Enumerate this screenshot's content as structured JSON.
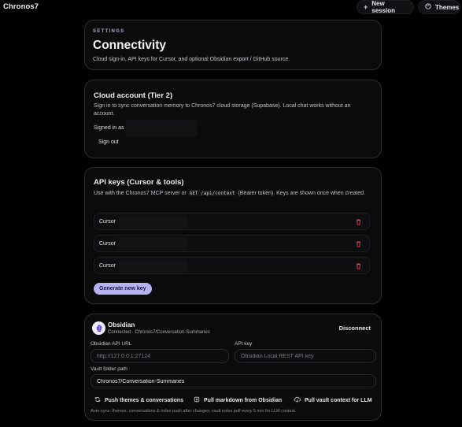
{
  "app": {
    "brand": "Chronos7"
  },
  "topbar": {
    "new_session": {
      "label": "New session",
      "icon": "plus-icon"
    },
    "themes": {
      "label": "Themes",
      "icon": "palette-icon"
    }
  },
  "settings": {
    "eyebrow": "SETTINGS",
    "title": "Connectivity",
    "subtitle": "Cloud sign-in, API keys for Cursor, and optional Obsidian export / GitHub source."
  },
  "cloud": {
    "title": "Cloud account (Tier 2)",
    "desc": "Sign in to sync conversation memory to Chronos7 cloud storage (Supabase). Local chat works without an account.",
    "signed_in_label": "Signed in as",
    "sign_out": "Sign out"
  },
  "api_keys": {
    "title": "API keys (Cursor & tools)",
    "desc_pre": "Use with the Chronos7 MCP server or ",
    "desc_code": "GET /api/context",
    "desc_post": " (Bearer token). Keys are shown once when created.",
    "keys": [
      {
        "name": "Cursor"
      },
      {
        "name": "Cursor"
      },
      {
        "name": "Cursor"
      }
    ],
    "generate": "Generate new key",
    "delete_color": "#e5484d",
    "accent": "#b9b2f2"
  },
  "obsidian": {
    "name": "Obsidian",
    "status": "Connected · Chronos7/Conversation-Summaries",
    "disconnect": "Disconnect",
    "url_label": "Obsidian API URL",
    "url_placeholder": "http://127.0.0.1:27124",
    "key_label": "API key",
    "key_placeholder": "Obsidian Local REST API key",
    "vault_label": "Vault folder path",
    "vault_value": "Chronos7/Conversation-Summaries",
    "actions": {
      "push": "Push themes & conversations",
      "pull_md": "Pull markdown from Obsidian",
      "pull_vault": "Pull vault context for LLM"
    },
    "autosync": "Auto-sync: themes, conversations & index push after changes; vault notes pull every 5 min for LLM context."
  }
}
